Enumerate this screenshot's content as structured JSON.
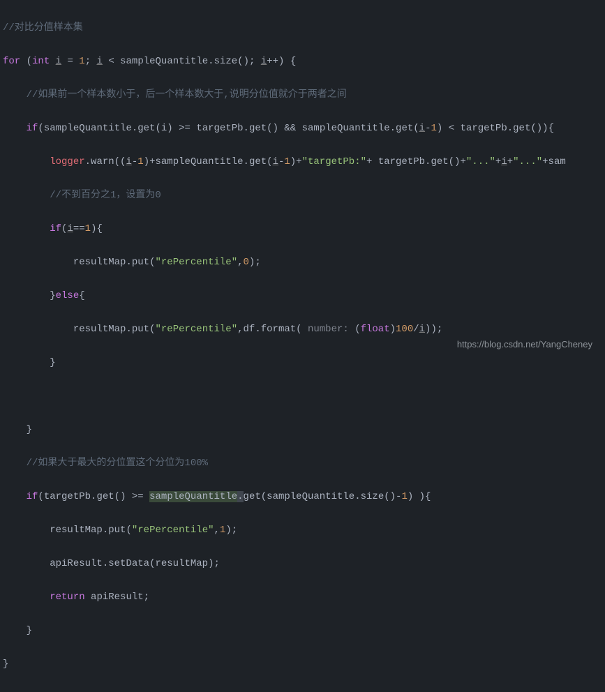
{
  "code": {
    "l1": "//对比分值样本集",
    "l2a": "for",
    "l2b": "int",
    "l2c": "i",
    "l2d": "1",
    "l2e": "i",
    "l2f": "sampleQuantitle",
    "l2g": "size",
    "l2h": "i",
    "l3": "//如果前一个样本数小于，后一个样本数大于,说明分位值就介于两者之间",
    "l4a": "if",
    "l4b": "sampleQuantitle",
    "l4c": "get",
    "l4d": "i",
    "l4e": "targetPb",
    "l4f": "get",
    "l4g": "sampleQuantitle",
    "l4h": "get",
    "l4i": "i",
    "l4j": "1",
    "l4k": "targetPb",
    "l4l": "get",
    "l5a": "logger",
    "l5b": "warn",
    "l5c": "i",
    "l5d": "1",
    "l5e": "sampleQuantitle",
    "l5f": "get",
    "l5g": "i",
    "l5h": "1",
    "l5i": "\"targetPb:\"",
    "l5j": "targetPb",
    "l5k": "get",
    "l5l": "\"...\"",
    "l5m": "i",
    "l5n": "\"...\"",
    "l5o": "sam",
    "l6": "//不到百分之1，设置为0",
    "l7a": "if",
    "l7b": "i",
    "l7c": "1",
    "l8a": "resultMap",
    "l8b": "put",
    "l8c": "\"rePercentile\"",
    "l8d": "0",
    "l9a": "else",
    "l10a": "resultMap",
    "l10b": "put",
    "l10c": "\"rePercentile\"",
    "l10d": "df",
    "l10e": "format",
    "l10f": "number:",
    "l10g": "float",
    "l10h": "100",
    "l10i": "i",
    "l13": "//如果大于最大的分位置这个分位为100%",
    "l14a": "if",
    "l14b": "targetPb",
    "l14c": "get",
    "l14d": "sampleQuantitle",
    "l14e": "get",
    "l14f": "sampleQuantitle",
    "l14g": "size",
    "l14h": "1",
    "l15a": "resultMap",
    "l15b": "put",
    "l15c": "\"rePercentile\"",
    "l15d": "1",
    "l16a": "apiResult",
    "l16b": "setData",
    "l16c": "resultMap",
    "l17a": "return",
    "l17b": "apiResult"
  },
  "watermark": "https://blog.csdn.net/YangCheney"
}
